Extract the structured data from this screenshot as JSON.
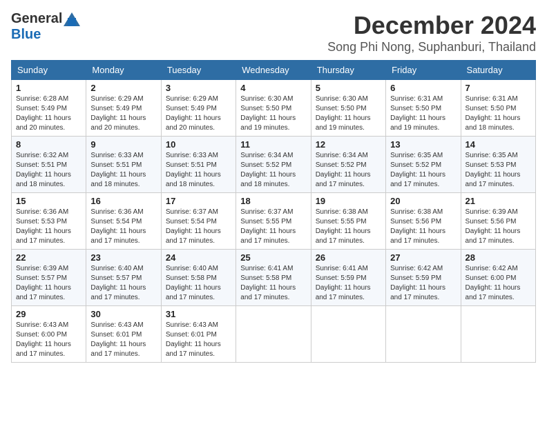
{
  "logo": {
    "general": "General",
    "blue": "Blue"
  },
  "title": {
    "month": "December 2024",
    "location": "Song Phi Nong, Suphanburi, Thailand"
  },
  "headers": [
    "Sunday",
    "Monday",
    "Tuesday",
    "Wednesday",
    "Thursday",
    "Friday",
    "Saturday"
  ],
  "weeks": [
    [
      {
        "day": "1",
        "sunrise": "6:28 AM",
        "sunset": "5:49 PM",
        "daylight": "11 hours and 20 minutes."
      },
      {
        "day": "2",
        "sunrise": "6:29 AM",
        "sunset": "5:49 PM",
        "daylight": "11 hours and 20 minutes."
      },
      {
        "day": "3",
        "sunrise": "6:29 AM",
        "sunset": "5:49 PM",
        "daylight": "11 hours and 20 minutes."
      },
      {
        "day": "4",
        "sunrise": "6:30 AM",
        "sunset": "5:50 PM",
        "daylight": "11 hours and 19 minutes."
      },
      {
        "day": "5",
        "sunrise": "6:30 AM",
        "sunset": "5:50 PM",
        "daylight": "11 hours and 19 minutes."
      },
      {
        "day": "6",
        "sunrise": "6:31 AM",
        "sunset": "5:50 PM",
        "daylight": "11 hours and 19 minutes."
      },
      {
        "day": "7",
        "sunrise": "6:31 AM",
        "sunset": "5:50 PM",
        "daylight": "11 hours and 18 minutes."
      }
    ],
    [
      {
        "day": "8",
        "sunrise": "6:32 AM",
        "sunset": "5:51 PM",
        "daylight": "11 hours and 18 minutes."
      },
      {
        "day": "9",
        "sunrise": "6:33 AM",
        "sunset": "5:51 PM",
        "daylight": "11 hours and 18 minutes."
      },
      {
        "day": "10",
        "sunrise": "6:33 AM",
        "sunset": "5:51 PM",
        "daylight": "11 hours and 18 minutes."
      },
      {
        "day": "11",
        "sunrise": "6:34 AM",
        "sunset": "5:52 PM",
        "daylight": "11 hours and 18 minutes."
      },
      {
        "day": "12",
        "sunrise": "6:34 AM",
        "sunset": "5:52 PM",
        "daylight": "11 hours and 17 minutes."
      },
      {
        "day": "13",
        "sunrise": "6:35 AM",
        "sunset": "5:52 PM",
        "daylight": "11 hours and 17 minutes."
      },
      {
        "day": "14",
        "sunrise": "6:35 AM",
        "sunset": "5:53 PM",
        "daylight": "11 hours and 17 minutes."
      }
    ],
    [
      {
        "day": "15",
        "sunrise": "6:36 AM",
        "sunset": "5:53 PM",
        "daylight": "11 hours and 17 minutes."
      },
      {
        "day": "16",
        "sunrise": "6:36 AM",
        "sunset": "5:54 PM",
        "daylight": "11 hours and 17 minutes."
      },
      {
        "day": "17",
        "sunrise": "6:37 AM",
        "sunset": "5:54 PM",
        "daylight": "11 hours and 17 minutes."
      },
      {
        "day": "18",
        "sunrise": "6:37 AM",
        "sunset": "5:55 PM",
        "daylight": "11 hours and 17 minutes."
      },
      {
        "day": "19",
        "sunrise": "6:38 AM",
        "sunset": "5:55 PM",
        "daylight": "11 hours and 17 minutes."
      },
      {
        "day": "20",
        "sunrise": "6:38 AM",
        "sunset": "5:56 PM",
        "daylight": "11 hours and 17 minutes."
      },
      {
        "day": "21",
        "sunrise": "6:39 AM",
        "sunset": "5:56 PM",
        "daylight": "11 hours and 17 minutes."
      }
    ],
    [
      {
        "day": "22",
        "sunrise": "6:39 AM",
        "sunset": "5:57 PM",
        "daylight": "11 hours and 17 minutes."
      },
      {
        "day": "23",
        "sunrise": "6:40 AM",
        "sunset": "5:57 PM",
        "daylight": "11 hours and 17 minutes."
      },
      {
        "day": "24",
        "sunrise": "6:40 AM",
        "sunset": "5:58 PM",
        "daylight": "11 hours and 17 minutes."
      },
      {
        "day": "25",
        "sunrise": "6:41 AM",
        "sunset": "5:58 PM",
        "daylight": "11 hours and 17 minutes."
      },
      {
        "day": "26",
        "sunrise": "6:41 AM",
        "sunset": "5:59 PM",
        "daylight": "11 hours and 17 minutes."
      },
      {
        "day": "27",
        "sunrise": "6:42 AM",
        "sunset": "5:59 PM",
        "daylight": "11 hours and 17 minutes."
      },
      {
        "day": "28",
        "sunrise": "6:42 AM",
        "sunset": "6:00 PM",
        "daylight": "11 hours and 17 minutes."
      }
    ],
    [
      {
        "day": "29",
        "sunrise": "6:43 AM",
        "sunset": "6:00 PM",
        "daylight": "11 hours and 17 minutes."
      },
      {
        "day": "30",
        "sunrise": "6:43 AM",
        "sunset": "6:01 PM",
        "daylight": "11 hours and 17 minutes."
      },
      {
        "day": "31",
        "sunrise": "6:43 AM",
        "sunset": "6:01 PM",
        "daylight": "11 hours and 17 minutes."
      },
      null,
      null,
      null,
      null
    ]
  ]
}
